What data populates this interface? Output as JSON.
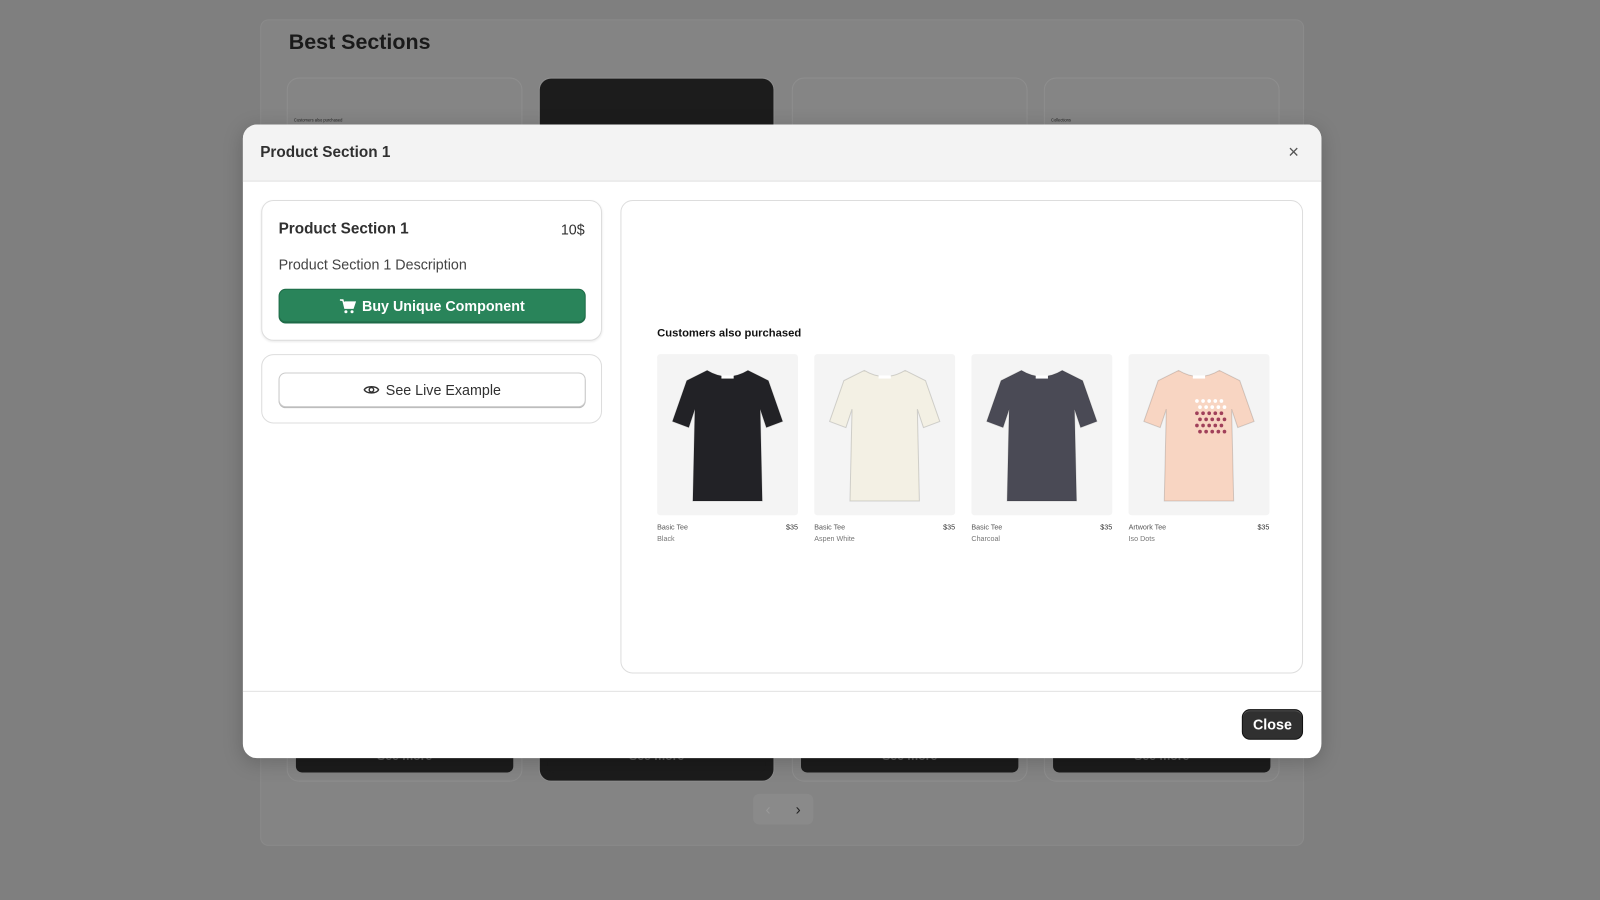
{
  "background": {
    "title": "Best Sections",
    "cards": [
      {
        "mini": "Customers also purchased",
        "button": "See more"
      },
      {
        "mini": "",
        "button": "See more"
      },
      {
        "mini": "",
        "button": "See more"
      },
      {
        "mini": "Collections",
        "button": "See more"
      }
    ],
    "pager": {
      "prev": "‹",
      "next": "›"
    }
  },
  "modal": {
    "title": "Product Section 1",
    "close_icon": "×",
    "product": {
      "name": "Product Section 1",
      "price": "10$",
      "description": "Product Section 1 Description"
    },
    "buy_label": "Buy Unique Component",
    "live_label": "See Live Example",
    "preview": {
      "title": "Customers also purchased",
      "products": [
        {
          "name": "Basic Tee",
          "price": "$35",
          "color": "Black",
          "shirt": "#222226"
        },
        {
          "name": "Basic Tee",
          "price": "$35",
          "color": "Aspen White",
          "shirt": "#f3f0e4"
        },
        {
          "name": "Basic Tee",
          "price": "$35",
          "color": "Charcoal",
          "shirt": "#4a4a55"
        },
        {
          "name": "Artwork Tee",
          "price": "$35",
          "color": "Iso Dots",
          "shirt": "#f8d5c2"
        }
      ]
    },
    "close_label": "Close"
  },
  "colors": {
    "accent": "#29845a",
    "dark": "#303030"
  }
}
